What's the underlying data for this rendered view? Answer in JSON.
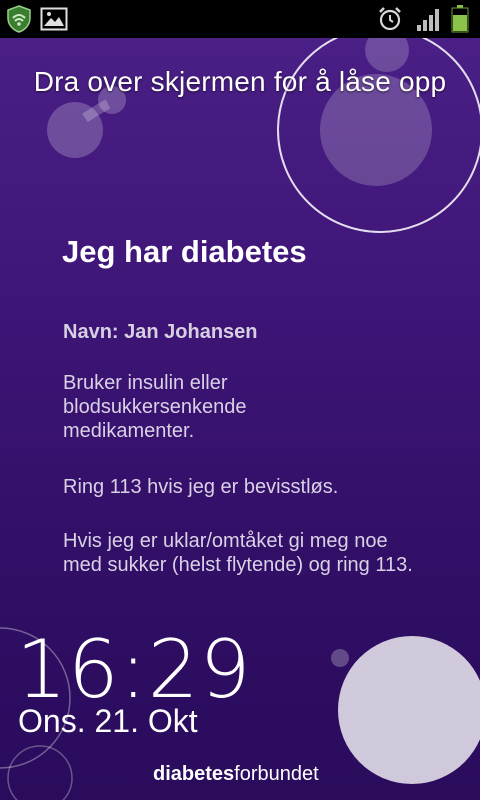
{
  "status_bar": {
    "left_icons": [
      "shield-icon",
      "image-icon"
    ],
    "right_icons": [
      "alarm-clock-icon",
      "signal-icon",
      "battery-icon"
    ],
    "colors": {
      "shield": "#4caf50",
      "battery": "#8bc34a"
    }
  },
  "lock_screen": {
    "unlock_hint": "Dra over skjermen for å låse opp",
    "card": {
      "title": "Jeg har diabetes",
      "name_line": "Navn: Jan Johansen",
      "info_1": "Bruker insulin eller blodsukkersenkende medikamenter.",
      "info_2": "Ring 113 hvis jeg er bevisstløs.",
      "info_3": "Hvis jeg er uklar/omtåket gi meg noe med sukker (helst flytende) og ring 113."
    },
    "clock": {
      "time": "16:29",
      "date": "Ons. 21. Okt"
    },
    "brand": {
      "bold_part": "diabetes",
      "regular_part": "forbundet"
    },
    "colors": {
      "background_top": "#4a1f86",
      "background_bottom": "#2a0b5c",
      "text": "#ffffff"
    }
  }
}
